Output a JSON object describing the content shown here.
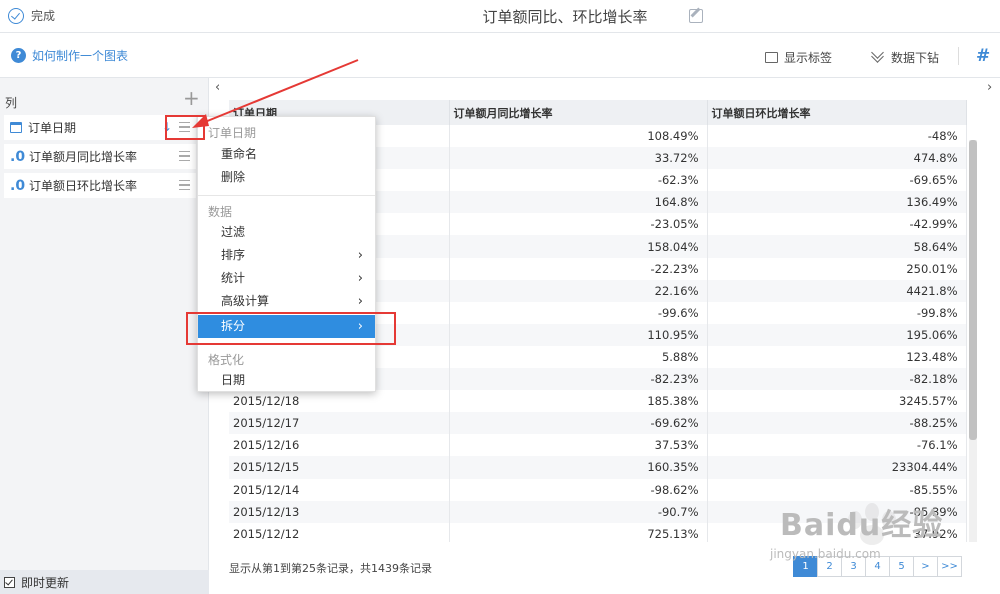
{
  "topbar": {
    "done_label": "完成",
    "title": "订单额同比、环比增长率"
  },
  "subbar": {
    "help_link": "如何制作一个图表",
    "show_labels": "显示标签",
    "drill_down": "数据下钻",
    "grid_icon": "#"
  },
  "left_panel": {
    "columns_title": "列",
    "add_symbol": "+",
    "fields": [
      {
        "label": "订单日期",
        "type": "date"
      },
      {
        "label": "订单额月同比增长率",
        "type": "number"
      },
      {
        "label": "订单额日环比增长率",
        "type": "number"
      }
    ],
    "number_icon": ".0",
    "sort_icon": "↓",
    "auto_update": "即时更新"
  },
  "nav": {
    "left": "‹",
    "right": "›"
  },
  "table": {
    "headers": [
      "订单日期",
      "订单额月同比增长率",
      "订单额日环比增长率"
    ],
    "rows": [
      [
        "",
        "108.49%",
        "-48%"
      ],
      [
        "",
        "33.72%",
        "474.8%"
      ],
      [
        "",
        "-62.3%",
        "-69.65%"
      ],
      [
        "",
        "164.8%",
        "136.49%"
      ],
      [
        "",
        "-23.05%",
        "-42.99%"
      ],
      [
        "",
        "158.04%",
        "58.64%"
      ],
      [
        "",
        "-22.23%",
        "250.01%"
      ],
      [
        "",
        "22.16%",
        "4421.8%"
      ],
      [
        "",
        "-99.6%",
        "-99.8%"
      ],
      [
        "",
        "110.95%",
        "195.06%"
      ],
      [
        "",
        "5.88%",
        "123.48%"
      ],
      [
        "",
        "-82.23%",
        "-82.18%"
      ],
      [
        "2015/12/18",
        "185.38%",
        "3245.57%"
      ],
      [
        "2015/12/17",
        "-69.62%",
        "-88.25%"
      ],
      [
        "2015/12/16",
        "37.53%",
        "-76.1%"
      ],
      [
        "2015/12/15",
        "160.35%",
        "23304.44%"
      ],
      [
        "2015/12/14",
        "-98.62%",
        "-85.55%"
      ],
      [
        "2015/12/13",
        "-90.7%",
        "-85.39%"
      ],
      [
        "2015/12/12",
        "725.13%",
        "37.92%"
      ]
    ]
  },
  "footer": {
    "record_text": "显示从第1到第25条记录，共1439条记录",
    "pages": [
      "1",
      "2",
      "3",
      "4",
      "5",
      ">",
      ">>"
    ],
    "current_page": "1"
  },
  "context_menu": {
    "field_heading": "订单日期",
    "rename": "重命名",
    "delete": "删除",
    "data_heading": "数据",
    "filter": "过滤",
    "sort": "排序",
    "stats": "统计",
    "advanced_calc": "高级计算",
    "split": "拆分",
    "format_heading": "格式化",
    "date": "日期",
    "submenu_arrow": "›"
  },
  "watermark": {
    "brand": "Baidu经验",
    "sub": "jingyan.baidu.com"
  },
  "colors": {
    "accent": "#3f8ad6",
    "menu_highlight": "#2f8de0",
    "annotation": "#e53935"
  }
}
